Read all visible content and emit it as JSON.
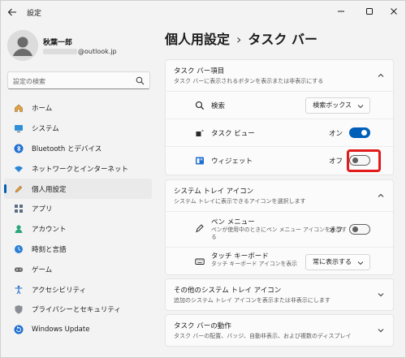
{
  "window": {
    "title": "設定",
    "controls": [
      "minimize-icon",
      "maximize-icon",
      "close-icon"
    ]
  },
  "profile": {
    "name": "秋葉一郎",
    "email_suffix": "@outlook.jp"
  },
  "search": {
    "placeholder": "設定の検索",
    "icon": "search-icon"
  },
  "sidebar": {
    "items": [
      {
        "label": "ホーム",
        "icon": "home-icon",
        "active": false
      },
      {
        "label": "システム",
        "icon": "system-monitor-icon",
        "active": false
      },
      {
        "label": "Bluetooth とデバイス",
        "icon": "bluetooth-icon",
        "active": false
      },
      {
        "label": "ネットワークとインターネット",
        "icon": "wifi-icon",
        "active": false
      },
      {
        "label": "個人用設定",
        "icon": "pen-icon",
        "active": true
      },
      {
        "label": "アプリ",
        "icon": "apps-icon",
        "active": false
      },
      {
        "label": "アカウント",
        "icon": "account-icon",
        "active": false
      },
      {
        "label": "時刻と言語",
        "icon": "globe-clock-icon",
        "active": false
      },
      {
        "label": "ゲーム",
        "icon": "gamepad-icon",
        "active": false
      },
      {
        "label": "アクセシビリティ",
        "icon": "accessibility-icon",
        "active": false
      },
      {
        "label": "プライバシーとセキュリティ",
        "icon": "shield-icon",
        "active": false
      },
      {
        "label": "Windows Update",
        "icon": "update-icon",
        "active": false
      }
    ]
  },
  "main": {
    "breadcrumb_parent": "個人用設定",
    "breadcrumb_sep": "›",
    "breadcrumb_current": "タスク バー",
    "taskbar_items": {
      "title": "タスク バー項目",
      "subtitle": "タスク バーに表示されるボタンを表示または非表示にする",
      "search": {
        "label": "検索",
        "value": "検索ボックス"
      },
      "taskview": {
        "label": "タスク ビュー",
        "state_label": "オン",
        "on": true
      },
      "widgets": {
        "label": "ウィジェット",
        "state_label": "オフ",
        "on": false
      }
    },
    "tray_icons": {
      "title": "システム トレイ アイコン",
      "subtitle": "システム トレイに表示できるアイコンを選択します",
      "pen_menu": {
        "label": "ペン メニュー",
        "sub": "ペンが使用中のときにペン メニュー アイコンを表示する",
        "state_label": "オフ",
        "on": false
      },
      "touch_keyboard": {
        "label": "タッチ キーボード",
        "sub": "タッチ キーボード アイコンを表示",
        "value": "常に表示する"
      }
    },
    "other_tray": {
      "title": "その他のシステム トレイ アイコン",
      "subtitle": "追加のシステム トレイ アイコンを表示または非表示にします"
    },
    "behaviors": {
      "title": "タスク バーの動作",
      "subtitle": "タスク バーの配置、バッジ、自動非表示、および複数のディスプレイ"
    }
  },
  "colors": {
    "accent": "#005fb8",
    "highlight": "#e21b1b"
  }
}
